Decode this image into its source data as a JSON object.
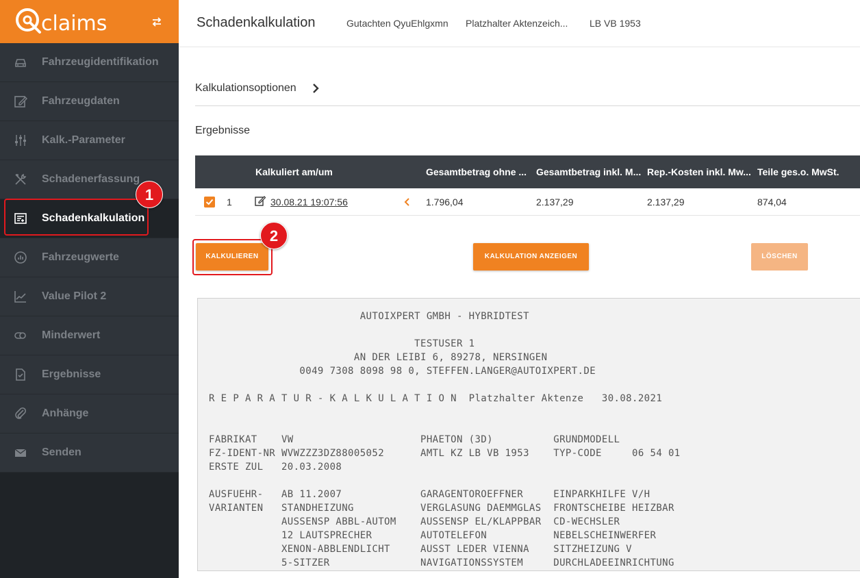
{
  "brand": {
    "logo_text": "claims",
    "accent": "#f08221",
    "sidebar_bg": "#2f343a"
  },
  "sidebar": {
    "items": [
      {
        "label": "Fahrzeugidentifikation",
        "icon": "car-icon"
      },
      {
        "label": "Fahrzeugdaten",
        "icon": "edit-icon"
      },
      {
        "label": "Kalk.-Parameter",
        "icon": "sliders-icon"
      },
      {
        "label": "Schadenerfassung",
        "icon": "tools-icon"
      },
      {
        "label": "Schadenkalkulation",
        "icon": "calculation-icon",
        "active": true
      },
      {
        "label": "Fahrzeugwerte",
        "icon": "gauge-icon"
      },
      {
        "label": "Value Pilot 2",
        "icon": "line-chart-icon"
      },
      {
        "label": "Minderwert",
        "icon": "coins-icon"
      },
      {
        "label": "Ergebnisse",
        "icon": "document-check-icon"
      },
      {
        "label": "Anhänge",
        "icon": "paperclip-icon"
      },
      {
        "label": "Senden",
        "icon": "mail-icon"
      }
    ]
  },
  "annotations": {
    "badge1": "1",
    "badge2": "2",
    "highlight_color": "#e2191e"
  },
  "header": {
    "title": "Schadenkalkulation",
    "meta1": "Gutachten QyuEhlgxmn",
    "meta2": "Platzhalter Aktenzeich...",
    "meta3": "LB VB 1953"
  },
  "main": {
    "options_label": "Kalkulationsoptionen",
    "results_title": "Ergebnisse",
    "table": {
      "headers": [
        "Kalkuliert am/um",
        "Gesamtbetrag ohne ...",
        "Gesamtbetrag inkl. M...",
        "Rep.-Kosten inkl. Mw...",
        "Teile ges.o. MwSt."
      ],
      "rows": [
        {
          "index": "1",
          "date": "30.08.21 19:07:56",
          "gesamt_ohne": "1.796,04",
          "gesamt_inkl": "2.137,29",
          "rep_kosten": "2.137,29",
          "teile": "874,04",
          "checked": true
        }
      ]
    },
    "buttons": {
      "calculate": "KALKULIEREN",
      "show": "KALKULATION ANZEIGEN",
      "delete": "LÖSCHEN"
    }
  },
  "report": {
    "lines": [
      "                         AUTOIXPERT GMBH - HYBRIDTEST",
      "",
      "                                  TESTUSER 1",
      "                        AN DER LEIBI 6, 89278, NERSINGEN",
      "               0049 7308 8098 98 0, STEFFEN.LANGER@AUTOIXPERT.DE",
      "",
      "R E P A R A T U R - K A L K U L A T I O N  Platzhalter Aktenze   30.08.2021",
      "",
      "",
      "FABRIKAT    VW                     PHAETON (3D)          GRUNDMODELL",
      "FZ-IDENT-NR WVWZZZ3DZ88005052      AMTL KZ LB VB 1953    TYP-CODE     06 54 01",
      "ERSTE ZUL   20.03.2008",
      "",
      "AUSFUEHR-   AB 11.2007             GARAGENTOROEFFNER     EINPARKHILFE V/H",
      "VARIANTEN   STANDHEIZUNG           VERGLASUNG DAEMMGLAS  FRONTSCHEIBE HEIZBAR",
      "            AUSSENSP ABBL-AUTOM    AUSSENSP EL/KLAPPBAR  CD-WECHSLER",
      "            12 LAUTSPRECHER        AUTOTELEFON           NEBELSCHEINWERFER",
      "            XENON-ABBLENDLICHT     AUSST LEDER VIENNA    SITZHEIZUNG V",
      "            5-SITZER               NAVIGATIONSSYSTEM     DURCHLADEEINRICHTUNG"
    ]
  }
}
